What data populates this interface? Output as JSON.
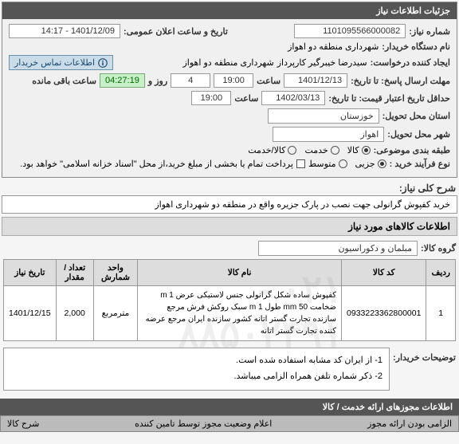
{
  "header": {
    "title": "جزئیات اطلاعات نیاز"
  },
  "fields": {
    "reqNoLabel": "شماره نیاز:",
    "reqNo": "1101095566000082",
    "pubDateLabel": "تاریخ و ساعت اعلان عمومی:",
    "pubDate": "1401/12/09 - 14:17",
    "buyerOrgLabel": "نام دستگاه خریدار:",
    "buyerOrg": "شهرداری منطقه دو اهواز",
    "creatorLabel": "ایجاد کننده درخواست:",
    "creatorName": "سیدرضا خیبرگیر کارپرداز",
    "creatorOrg": "شهرداری منطقه دو اهواز",
    "contactLink": "اطلاعات تماس خریدار",
    "respDeadlineLabel": "مهلت ارسال پاسخ: تا تاریخ:",
    "respDeadlineDate": "1401/12/13",
    "timeLabel": "ساعت",
    "respDeadlineTime": "19:00",
    "daysLabel": "روز و",
    "days": "4",
    "countdown": "04:27:19",
    "remainingLabel": "ساعت باقی مانده",
    "minValidLabel": "حداقل تاریخ اعتبار قیمت: تا تاریخ:",
    "minValidDate": "1402/03/13",
    "minValidTime": "19:00",
    "provinceLabel": "استان محل تحویل:",
    "province": "خوزستان",
    "cityLabel": "شهر محل تحویل:",
    "city": "اهواز",
    "categoryLabel": "طبقه بندی موضوعی:",
    "catGoods": "کالا",
    "catService": "خدمت",
    "catBoth": "کالا/خدمت",
    "processLabel": "نوع فرآیند خرید :",
    "procPartial": "جزیی",
    "procMedium": "متوسط",
    "paymentNote": "پرداخت تمام یا بخشی از مبلغ خرید،از محل \"اسناد خزانه اسلامی\" خواهد بود."
  },
  "descSection": {
    "titleLabel": "شرح کلی نیاز:",
    "title": "خرید کفپوش گرانولی جهت نصب در پارک جزیره واقع در منطقه دو شهرداری اهواز"
  },
  "itemsSection": {
    "header": "اطلاعات کالاهای مورد نیاز",
    "groupLabel": "گروه کالا:",
    "group": "مبلمان و دکوراسیون",
    "columns": {
      "row": "ردیف",
      "code": "کد کالا",
      "name": "نام کالا",
      "unit": "واحد شمارش",
      "qty": "تعداد / مقدار",
      "date": "تاریخ نیاز"
    },
    "rows": [
      {
        "row": "1",
        "code": "0933223362800001",
        "name": "کفپوش ساده شکل گرانولی جنس لاستیکی عرض m 1 ضخامت mm 50 طول m 1 سبک روکش فرش مرجع سازنده تجارت گستر اتانه کشور سازنده ایران مرجع عرضه کننده تجارت گستر اتانه",
        "unit": "مترمربع",
        "qty": "2,000",
        "date": "1401/12/15"
      }
    ]
  },
  "notes": {
    "label": "توضیحات خریدار:",
    "line1": "1- از ایران کد مشابه استفاده شده است.",
    "line2": "2- ذکر شماره تلفن همراه الزامی میباشد."
  },
  "footer": {
    "tab1": "اطلاعات مجوزهای ارائه خدمت / کالا",
    "sub1": "الزامی بودن ارائه مجوز",
    "sub2": "اعلام وضعیت مجوز توسط تامین کننده",
    "sub3": "شرح کالا"
  }
}
